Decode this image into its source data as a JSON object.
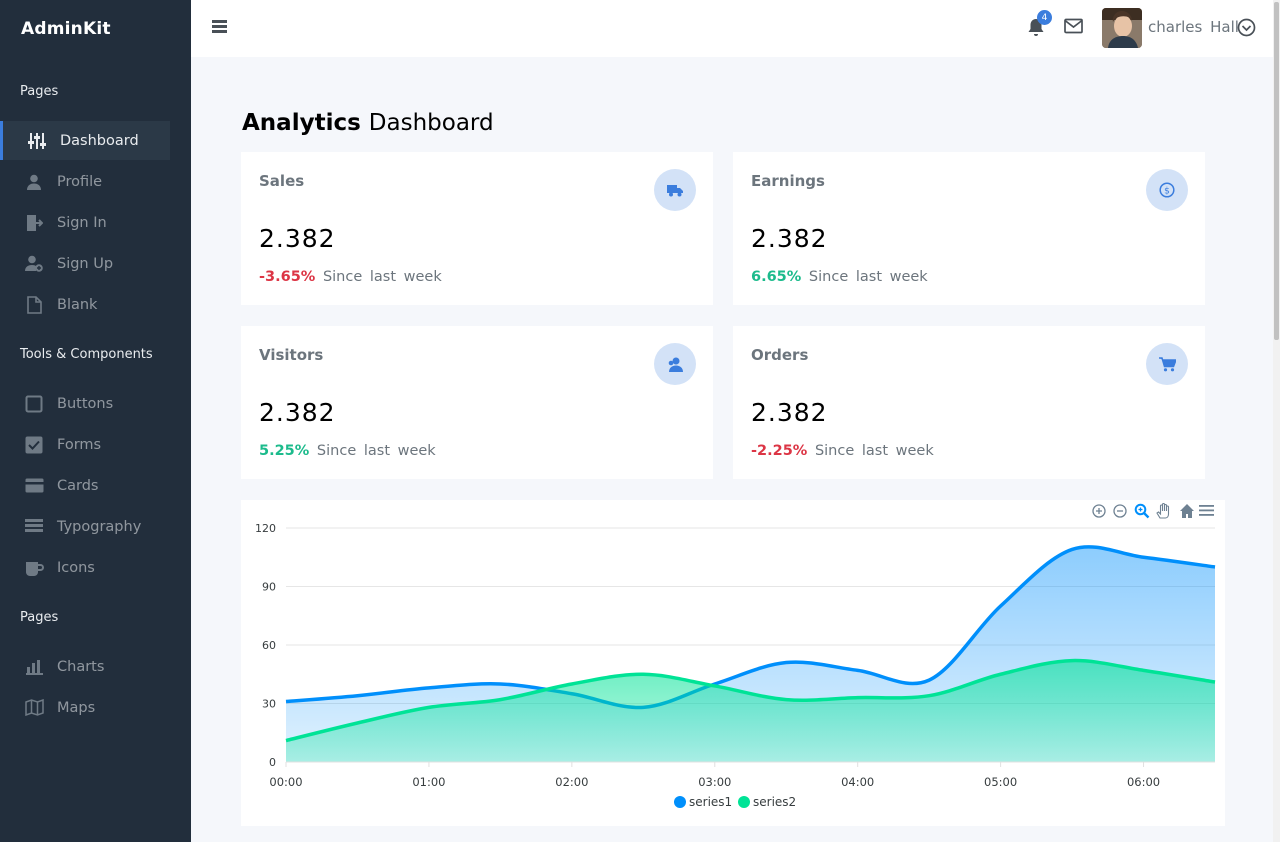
{
  "sidebar": {
    "brand": "AdminKit",
    "sections": [
      {
        "header": "Pages",
        "items": [
          {
            "label": "Dashboard",
            "icon": "sliders-icon",
            "active": true
          },
          {
            "label": "Profile",
            "icon": "user-icon"
          },
          {
            "label": "Sign In",
            "icon": "log-in-icon"
          },
          {
            "label": "Sign Up",
            "icon": "user-plus-icon"
          },
          {
            "label": "Blank",
            "icon": "file-icon"
          }
        ]
      },
      {
        "header": "Tools & Components",
        "items": [
          {
            "label": "Buttons",
            "icon": "square-icon"
          },
          {
            "label": "Forms",
            "icon": "check-square-icon"
          },
          {
            "label": "Cards",
            "icon": "credit-card-icon"
          },
          {
            "label": "Typography",
            "icon": "align-left-icon"
          },
          {
            "label": "Icons",
            "icon": "coffee-icon"
          }
        ]
      },
      {
        "header": "Pages",
        "items": [
          {
            "label": "Charts",
            "icon": "bar-chart-icon"
          },
          {
            "label": "Maps",
            "icon": "map-icon"
          }
        ]
      }
    ]
  },
  "navbar": {
    "notification_count": "4",
    "user_name": "charles Hall"
  },
  "page": {
    "title_bold": "Analytics",
    "title_light": "Dashboard"
  },
  "cards": [
    {
      "title": "Sales",
      "value": "2.382",
      "change": "-3.65%",
      "trend": "negative",
      "since": "Since last week",
      "icon": "truck-icon"
    },
    {
      "title": "Earnings",
      "value": "2.382",
      "change": "6.65%",
      "trend": "positive",
      "since": "Since last week",
      "icon": "dollar-icon"
    },
    {
      "title": "Visitors",
      "value": "2.382",
      "change": "5.25%",
      "trend": "positive",
      "since": "Since last week",
      "icon": "users-icon"
    },
    {
      "title": "Orders",
      "value": "2.382",
      "change": "-2.25%",
      "trend": "negative",
      "since": "Since last week",
      "icon": "shopping-cart-icon"
    }
  ],
  "colors": {
    "sidebar_bg": "#222e3c",
    "primary": "#3b7ddd",
    "success": "#1cbb8c",
    "danger": "#dc3545",
    "series1": "#008ffb",
    "series2": "#00e396"
  },
  "chart_data": {
    "type": "area",
    "x": [
      "00:00",
      "01:00",
      "02:00",
      "03:00",
      "04:00",
      "05:00",
      "06:00"
    ],
    "x_values": [
      0,
      0.5,
      1,
      1.5,
      2,
      2.5,
      3,
      3.5,
      4,
      4.5,
      5,
      5.5,
      6,
      6.5
    ],
    "series": [
      {
        "name": "series1",
        "values": [
          31,
          34,
          38,
          40,
          35,
          28,
          40,
          51,
          47,
          42,
          80,
          109,
          105,
          100
        ]
      },
      {
        "name": "series2",
        "values": [
          11,
          20,
          28,
          32,
          40,
          45,
          39,
          32,
          33,
          34,
          45,
          52,
          47,
          41
        ]
      }
    ],
    "ylim": [
      0,
      120
    ],
    "yticks": [
      0,
      30,
      60,
      90,
      120
    ],
    "grid": true,
    "legend": "bottom-center",
    "toolbar": [
      "zoom-in-icon",
      "zoom-out-icon",
      "zoom-selection-icon",
      "pan-icon",
      "reset-home-icon",
      "menu-icon"
    ]
  }
}
